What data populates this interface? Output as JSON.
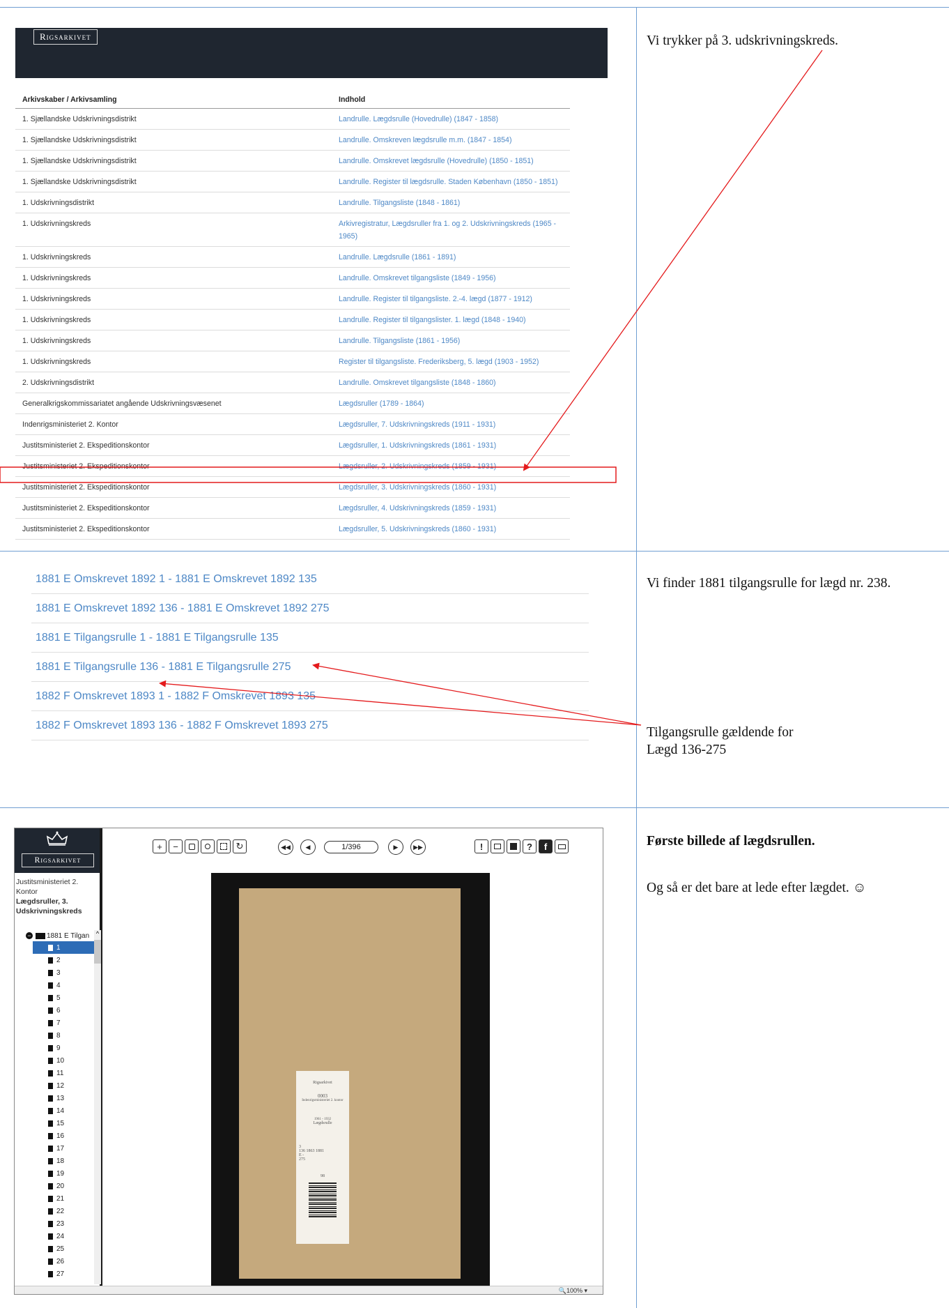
{
  "section1": {
    "logo": "Rigsarkivet",
    "table": {
      "headers": [
        "Arkivskaber / Arkivsamling",
        "Indhold"
      ],
      "rows": [
        [
          "1. Sjællandske Udskrivningsdistrikt",
          "Landrulle. Lægdsrulle (Hovedrulle) (1847 - 1858)"
        ],
        [
          "1. Sjællandske Udskrivningsdistrikt",
          "Landrulle. Omskreven lægdsrulle m.m. (1847 - 1854)"
        ],
        [
          "1. Sjællandske Udskrivningsdistrikt",
          "Landrulle. Omskrevet lægdsrulle (Hovedrulle) (1850 - 1851)"
        ],
        [
          "1. Sjællandske Udskrivningsdistrikt",
          "Landrulle. Register til lægdsrulle. Staden København (1850 - 1851)"
        ],
        [
          "1. Udskrivningsdistrikt",
          "Landrulle. Tilgangsliste (1848 - 1861)"
        ],
        [
          "1. Udskrivningskreds",
          "Arkivregistratur, Lægdsruller fra 1. og 2. Udskrivningskreds (1965 - 1965)"
        ],
        [
          "1. Udskrivningskreds",
          "Landrulle. Lægdsrulle (1861 - 1891)"
        ],
        [
          "1. Udskrivningskreds",
          "Landrulle. Omskrevet tilgangsliste (1849 - 1956)"
        ],
        [
          "1. Udskrivningskreds",
          "Landrulle. Register til tilgangsliste. 2.-4. lægd (1877 - 1912)"
        ],
        [
          "1. Udskrivningskreds",
          "Landrulle. Register til tilgangslister. 1. lægd (1848 - 1940)"
        ],
        [
          "1. Udskrivningskreds",
          "Landrulle. Tilgangsliste (1861 - 1956)"
        ],
        [
          "1. Udskrivningskreds",
          "Register til tilgangsliste. Frederiksberg, 5. lægd (1903 - 1952)"
        ],
        [
          "2. Udskrivningsdistrikt",
          "Landrulle. Omskrevet tilgangsliste (1848 - 1860)"
        ],
        [
          "Generalkrigskommissariatet angående Udskrivningsvæsenet",
          "Lægdsruller (1789 - 1864)"
        ],
        [
          "Indenrigsministeriet 2. Kontor",
          "Lægdsruller, 7. Udskrivningskreds (1911 - 1931)"
        ],
        [
          "Justitsministeriet 2. Ekspeditionskontor",
          "Lægdsruller, 1. Udskrivningskreds (1861 - 1931)"
        ],
        [
          "Justitsministeriet 2. Ekspeditionskontor",
          "Lægdsruller, 2. Udskrivningskreds (1859 - 1931)"
        ],
        [
          "Justitsministeriet 2. Ekspeditionskontor",
          "Lægdsruller, 3. Udskrivningskreds (1860 - 1931)"
        ],
        [
          "Justitsministeriet 2. Ekspeditionskontor",
          "Lægdsruller, 4. Udskrivningskreds (1859 - 1931)"
        ],
        [
          "Justitsministeriet 2. Ekspeditionskontor",
          "Lægdsruller, 5. Udskrivningskreds (1860 - 1931)"
        ]
      ]
    },
    "note": "Vi trykker på 3. udskrivningskreds."
  },
  "section2": {
    "rolls": [
      "1881 E Omskrevet 1892 1 - 1881 E Omskrevet 1892 135",
      "1881 E Omskrevet 1892 136 - 1881 E Omskrevet 1892 275",
      "1881 E Tilgangsrulle 1 - 1881 E Tilgangsrulle 135",
      "1881 E Tilgangsrulle 136 - 1881 E Tilgangsrulle 275",
      "1882 F Omskrevet 1893 1 - 1882 F Omskrevet 1893 135",
      "1882 F Omskrevet 1893 136 - 1882 F Omskrevet 1893 275"
    ],
    "note_top": "Vi finder 1881 tilgangsrulle for lægd nr. 238.",
    "note_arrow_line1": "Tilgangsrulle gældende for",
    "note_arrow_line2": "Lægd 136-275"
  },
  "section3": {
    "logo": "Rigsarkivet",
    "crumb_line1": "Justitsministeriet 2. Kontor",
    "crumb_bold": "Lægdsruller, 3. Udskrivningskreds",
    "folder": "1881 E Tilgan",
    "leaves": [
      "1",
      "2",
      "3",
      "4",
      "5",
      "6",
      "7",
      "8",
      "9",
      "10",
      "11",
      "12",
      "13",
      "14",
      "15",
      "16",
      "17",
      "18",
      "19",
      "20",
      "21",
      "22",
      "23",
      "24",
      "25",
      "26",
      "27"
    ],
    "page_field": "1/396",
    "zoom": "100%",
    "label_text": {
      "l1": "Rigsarkivet",
      "l2": "0003",
      "l3": "Indenrigsministeriet 2. kontor",
      "l4": "1961 - 1932",
      "l5": "Lægdsrulle",
      "l6": "3",
      "l7": "136 1863 1881",
      "l8": "E -",
      "l9": "275",
      "l10": "98"
    },
    "note_bold": "Første billede af lægdsrullen.",
    "note_body": "Og så er det bare at lede efter lægdet. ☺"
  }
}
